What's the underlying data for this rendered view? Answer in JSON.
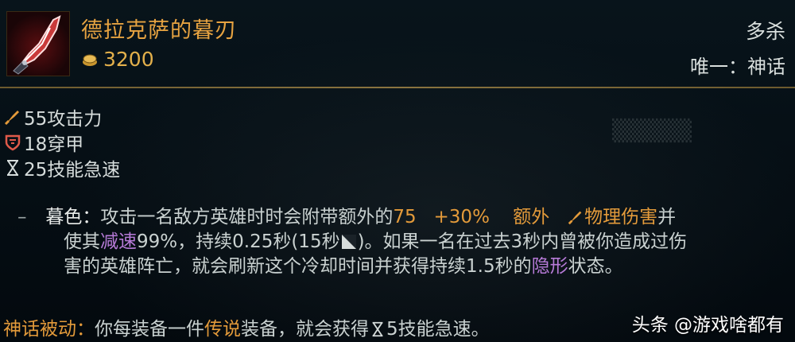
{
  "item": {
    "name": "德拉克萨的暮刃",
    "price": "3200",
    "icon": "blade-icon",
    "tag_top": "多杀",
    "tag_bottom": "唯一：神话"
  },
  "stats": [
    {
      "icon": "attack-damage-icon",
      "text": "55攻击力"
    },
    {
      "icon": "armor-pen-icon",
      "text": "18穿甲"
    },
    {
      "icon": "ability-haste-icon",
      "text": "25技能急速"
    }
  ],
  "passive": {
    "dash": "–",
    "name": "暮色：",
    "t1": "攻击一名敌方英雄时时会附带额外的",
    "val1": "75",
    "val2": "+30%",
    "val3": "额外",
    "dmg": "物理伤害",
    "t2": "并",
    "t3": "使其",
    "slow": "减速",
    "t4": "99%，持续0.25秒(15秒",
    "t5": ")。如果一名在过去3秒内曾被你造成过伤",
    "t6": "害的英雄阵亡，就会刷新这个冷却时间并获得持续1.5秒的",
    "stealth": "隐形",
    "t7": "状态。"
  },
  "mythic": {
    "label": "神话被动：",
    "t1": "你每装备一件",
    "legend": "传说",
    "t2": "装备，就会获得",
    "t3": "5技能急速。"
  },
  "watermark": "头条 @游戏啥都有",
  "colors": {
    "gold": "#e3b04b",
    "orange": "#e39a3a",
    "purple": "#b67ad7",
    "background": "#030b11"
  }
}
